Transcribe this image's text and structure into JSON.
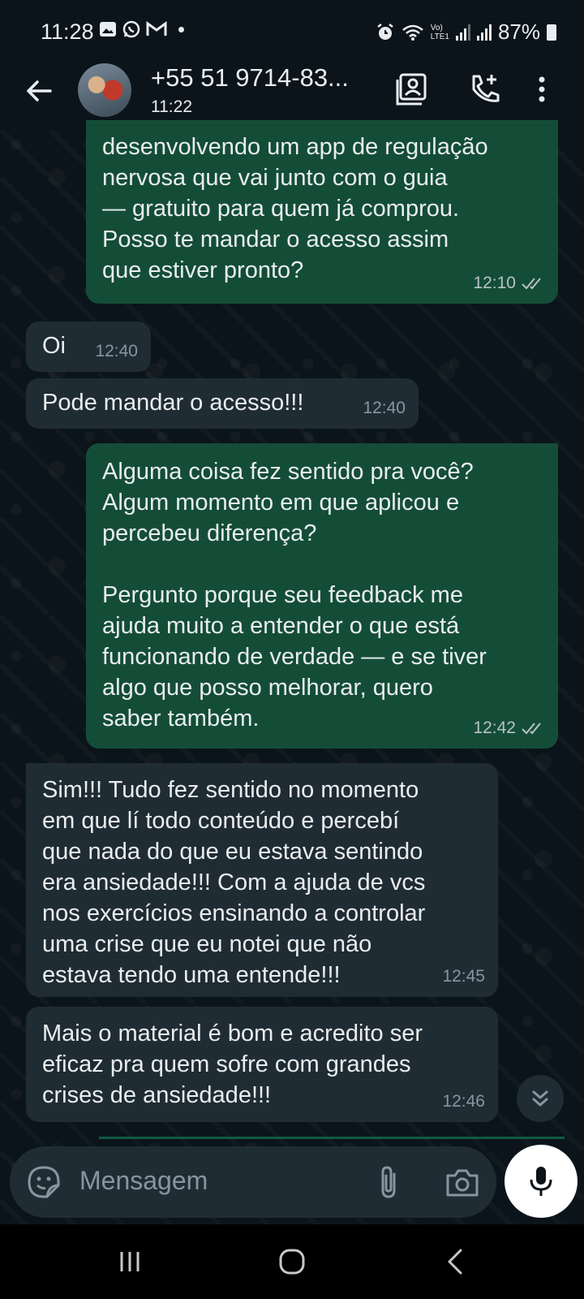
{
  "status_bar": {
    "time": "11:28",
    "left_icons": [
      "gallery-icon",
      "whatsapp-icon",
      "gmail-icon"
    ],
    "volte_label": "Vo)",
    "lte_label": "LTE1",
    "battery": "87%"
  },
  "header": {
    "contact": "+55 51 9714-83...",
    "subtitle": "11:22"
  },
  "messages": [
    {
      "direction": "out",
      "text": "desenvolvendo um app de regulação\nnervosa que vai junto com o guia\n— gratuito para quem já comprou.\nPosso te mandar o acesso assim\nque estiver pronto?",
      "time": "12:10",
      "status": "read"
    },
    {
      "direction": "in",
      "text": "Oi",
      "time": "12:40"
    },
    {
      "direction": "in",
      "text": "Pode mandar o acesso!!!",
      "time": "12:40"
    },
    {
      "direction": "out",
      "text": "Alguma coisa fez sentido pra você?\nAlgum momento em que aplicou e\npercebeu diferença?\n\nPergunto porque seu feedback me\najuda muito a entender o que está\nfuncionando de verdade — e se tiver\nalgo que posso melhorar, quero\nsaber também.",
      "time": "12:42",
      "status": "read"
    },
    {
      "direction": "in",
      "text": "Sim!!! Tudo fez sentido no momento\nem que lí todo conteúdo e percebí\nque nada do que eu estava sentindo\nera ansiedade!!! Com a ajuda de vcs\nnos exercícios ensinando a controlar\numa crise que eu notei que não\nestava tendo uma entende!!!",
      "time": "12:45"
    },
    {
      "direction": "in",
      "text": "Mais o material é bom e acredito ser\neficaz pra quem sofre com grandes\ncrises de ansiedade!!!",
      "time": "12:46"
    }
  ],
  "composer": {
    "placeholder": "Mensagem"
  },
  "colors": {
    "background": "#0b141a",
    "outgoing_bubble": "#144d37",
    "incoming_bubble": "#202c33",
    "accent": "#0e5a43"
  }
}
